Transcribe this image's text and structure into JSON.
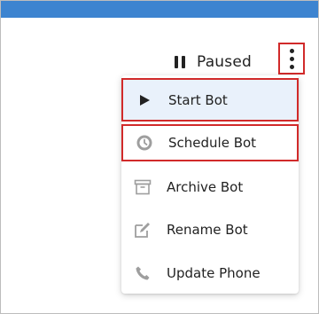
{
  "status": {
    "label": "Paused",
    "icon": "pause-icon"
  },
  "menu_button": {
    "icon": "kebab-menu-icon"
  },
  "menu": {
    "items": [
      {
        "label": "Start Bot",
        "icon": "play-icon",
        "highlighted": true
      },
      {
        "label": "Schedule Bot",
        "icon": "clock-icon",
        "highlighted": true
      },
      {
        "label": "Archive Bot",
        "icon": "archive-icon"
      },
      {
        "label": "Rename Bot",
        "icon": "edit-icon"
      },
      {
        "label": "Update Phone",
        "icon": "phone-icon"
      }
    ]
  },
  "colors": {
    "top_bar": "#3d84d0",
    "highlight_border": "#d12a2a",
    "selected_item_bg": "#e9f1fb",
    "icon_gray": "#9e9e9e"
  }
}
